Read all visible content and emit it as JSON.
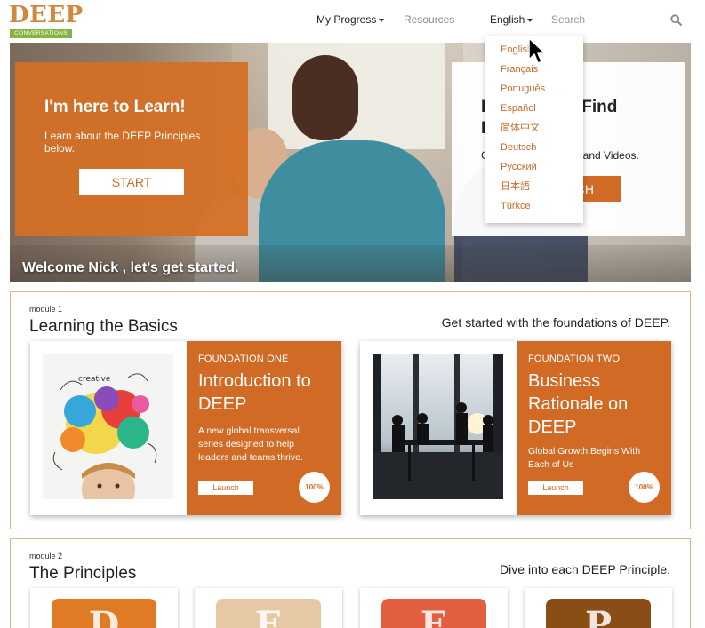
{
  "header": {
    "logo": {
      "word": "DEEP",
      "tagline": "CONVERSATIONS"
    },
    "nav": {
      "my_progress": "My Progress",
      "resources": "Resources",
      "language": "English"
    },
    "search": {
      "placeholder": "Search"
    }
  },
  "language_menu": {
    "items": [
      "English",
      "Français",
      "Português",
      "Español",
      "简体中文",
      "Deutsch",
      "Русский",
      "日本語",
      "Türkce"
    ]
  },
  "hero": {
    "learn": {
      "title": "I'm here to Learn!",
      "description": "Learn about the DEEP Principles below.",
      "button": "START"
    },
    "find": {
      "title_left": "I",
      "title_right": "Find",
      "line2": "I",
      "desc_left": "C",
      "desc_right": "and Videos.",
      "button": "CH"
    },
    "welcome": "Welcome Nick , let's get started."
  },
  "modules": [
    {
      "number": "module 1",
      "title": "Learning the Basics",
      "tagline": "Get started with the foundations of DEEP.",
      "foundations": [
        {
          "label": "FOUNDATION ONE",
          "title": "Introduction to DEEP",
          "description": "A new global transversal series designed to help leaders and teams thrive.",
          "launch": "Launch",
          "progress": "100%"
        },
        {
          "label": "FOUNDATION TWO",
          "title": "Business Rationale on DEEP",
          "description": "Global Growth Begins With Each of Us",
          "launch": "Launch",
          "progress": "100%"
        }
      ]
    },
    {
      "number": "module 2",
      "title": "The Principles",
      "tagline": "Dive into each DEEP Principle.",
      "principles": [
        {
          "letter": "D",
          "color": "#e07a24"
        },
        {
          "letter": "E",
          "color": "#e6c9a4"
        },
        {
          "letter": "E",
          "color": "#e35d3f"
        },
        {
          "letter": "P",
          "color": "#8a4d16"
        }
      ]
    }
  ],
  "colors": {
    "brand_orange": "#d06a24",
    "logo_orange": "#d2863e",
    "logo_green": "#86b341",
    "link_orange": "#c86a2a"
  }
}
